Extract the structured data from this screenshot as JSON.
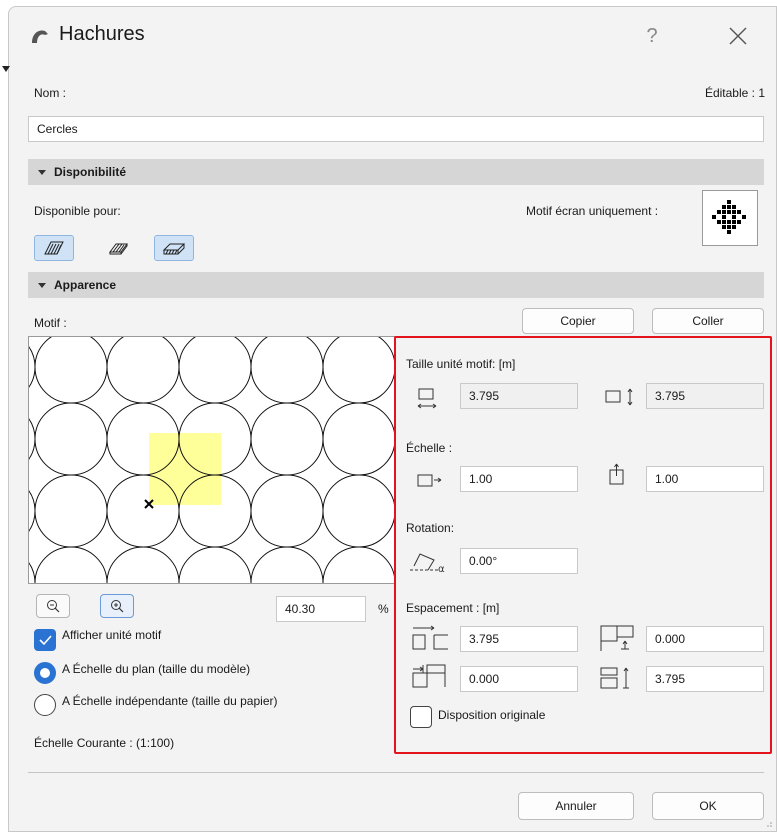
{
  "window": {
    "title": "Hachures",
    "help": "?"
  },
  "name_section": {
    "name_label": "Nom :",
    "editable": "Éditable : 1",
    "name_value": "Cercles"
  },
  "availability": {
    "header": "Disponibilité",
    "available_for": "Disponible pour:",
    "screen_only": "Motif écran uniquement :",
    "buttons": [
      {
        "icon": "fill-floor-plan-icon",
        "active": true
      },
      {
        "icon": "fill-cut-icon",
        "active": false
      },
      {
        "icon": "fill-cover-icon",
        "active": true
      }
    ]
  },
  "appearance": {
    "header": "Apparence",
    "motif_label": "Motif :",
    "copy_button": "Copier",
    "paste_button": "Coller",
    "zoom_value": "40.30",
    "zoom_unit": "%",
    "show_unit": "Afficher unité motif",
    "scale_plan": "A Échelle du plan (taille du modèle)",
    "scale_independent": "A Échelle indépendante (taille du papier)",
    "current_scale": "Échelle Courante : (1:100)",
    "show_unit_checked": true,
    "scale_plan_selected": true
  },
  "pattern_params": {
    "unit_size_label": "Taille unité motif: [m]",
    "unit_width": "3.795",
    "unit_height": "3.795",
    "scale_label": "Échelle :",
    "scale_x": "1.00",
    "scale_y": "1.00",
    "rotation_label": "Rotation:",
    "rotation_value": "0.00°",
    "spacing_label": "Espacement : [m]",
    "spacing_x": "3.795",
    "spacing_offset_y": "0.000",
    "spacing_offset_x": "0.000",
    "spacing_y": "3.795",
    "original_layout": "Disposition originale",
    "original_layout_checked": false
  },
  "footer": {
    "cancel": "Annuler",
    "ok": "OK"
  },
  "colors": {
    "accent": "#2b73d2",
    "highlight": "#ffff99",
    "red_frame": "#e3141c"
  }
}
